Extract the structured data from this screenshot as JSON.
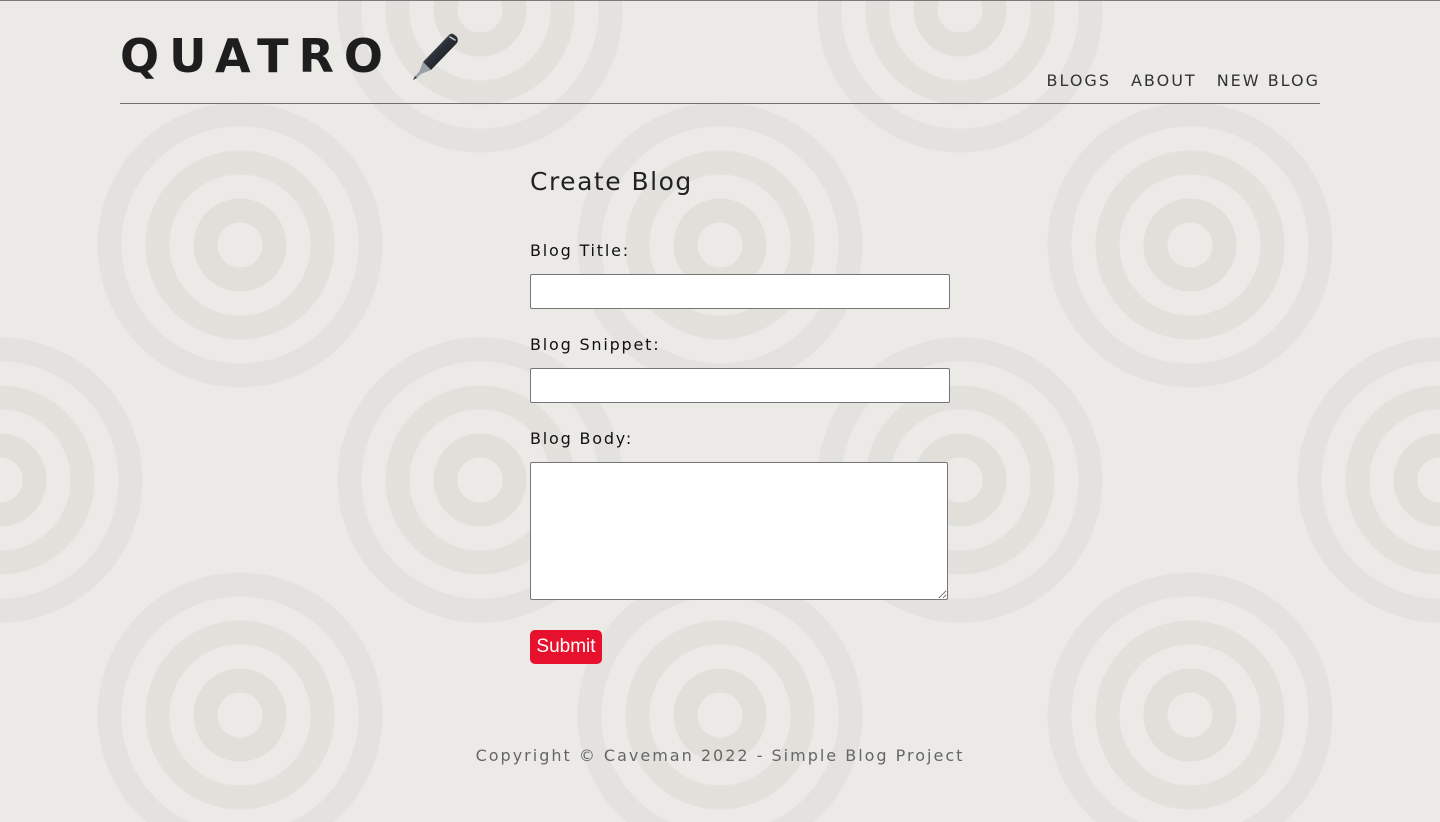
{
  "header": {
    "logo_text": "QUATRO",
    "logo_icon": "fountain-pen-icon",
    "nav": [
      {
        "label": "BLOGS"
      },
      {
        "label": "ABOUT"
      },
      {
        "label": "NEW BLOG"
      }
    ]
  },
  "form": {
    "title": "Create Blog",
    "title_label": "Blog Title:",
    "title_value": "",
    "snippet_label": "Blog Snippet:",
    "snippet_value": "",
    "body_label": "Blog Body:",
    "body_value": "",
    "submit_label": "Submit",
    "submit_color": "#e8112d"
  },
  "footer": {
    "text": "Copyright © Caveman 2022 - Simple Blog Project"
  },
  "colors": {
    "background": "#ebeae6",
    "text": "#222222",
    "accent": "#e8112d"
  }
}
